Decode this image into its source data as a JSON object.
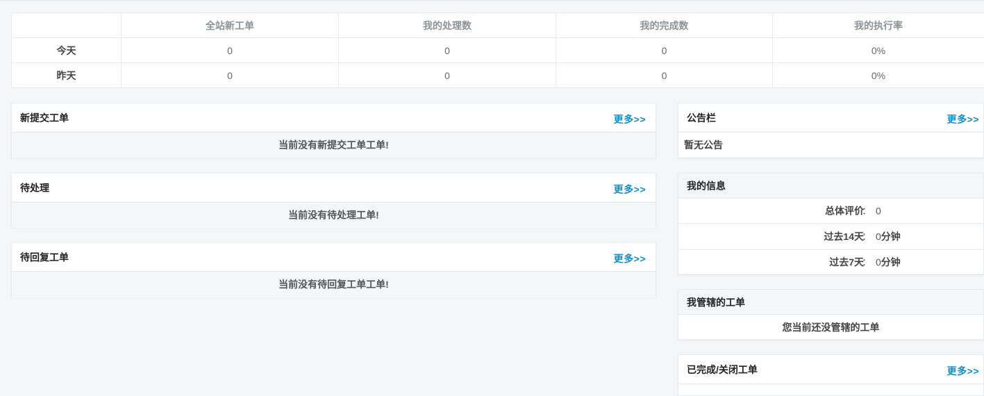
{
  "stats": {
    "headers": [
      "",
      "全站新工单",
      "我的处理数",
      "我的完成数",
      "我的执行率"
    ],
    "rows": [
      {
        "label": "今天",
        "values": [
          "0",
          "0",
          "0",
          "0%"
        ]
      },
      {
        "label": "昨天",
        "values": [
          "0",
          "0",
          "0",
          "0%"
        ]
      }
    ]
  },
  "more_label": "更多>>",
  "left_panels": {
    "new_tickets": {
      "title": "新提交工单",
      "empty": "当前没有新提交工单工单!"
    },
    "pending": {
      "title": "待处理",
      "empty": "当前没有待处理工单!"
    },
    "awaiting_reply": {
      "title": "待回复工单",
      "empty": "当前没有待回复工单工单!"
    }
  },
  "right_panels": {
    "bulletin": {
      "title": "公告栏",
      "body": "暂无公告"
    },
    "my_info": {
      "title": "我的信息",
      "rows": [
        {
          "label": "总体评价",
          "sep": "：",
          "value_num": "0",
          "value_unit": ""
        },
        {
          "label": "过去14天",
          "sep": "：",
          "value_num": "0",
          "value_unit": "分钟"
        },
        {
          "label": "过去7天",
          "sep": "：",
          "value_num": "0",
          "value_unit": "分钟"
        }
      ]
    },
    "managed": {
      "title": "我管辖的工单",
      "body": "您当前还没管辖的工单"
    },
    "completed": {
      "title": "已完成/关闭工单"
    }
  },
  "colors": {
    "accent": "#0e8ece",
    "background": "#f5f6f7"
  }
}
